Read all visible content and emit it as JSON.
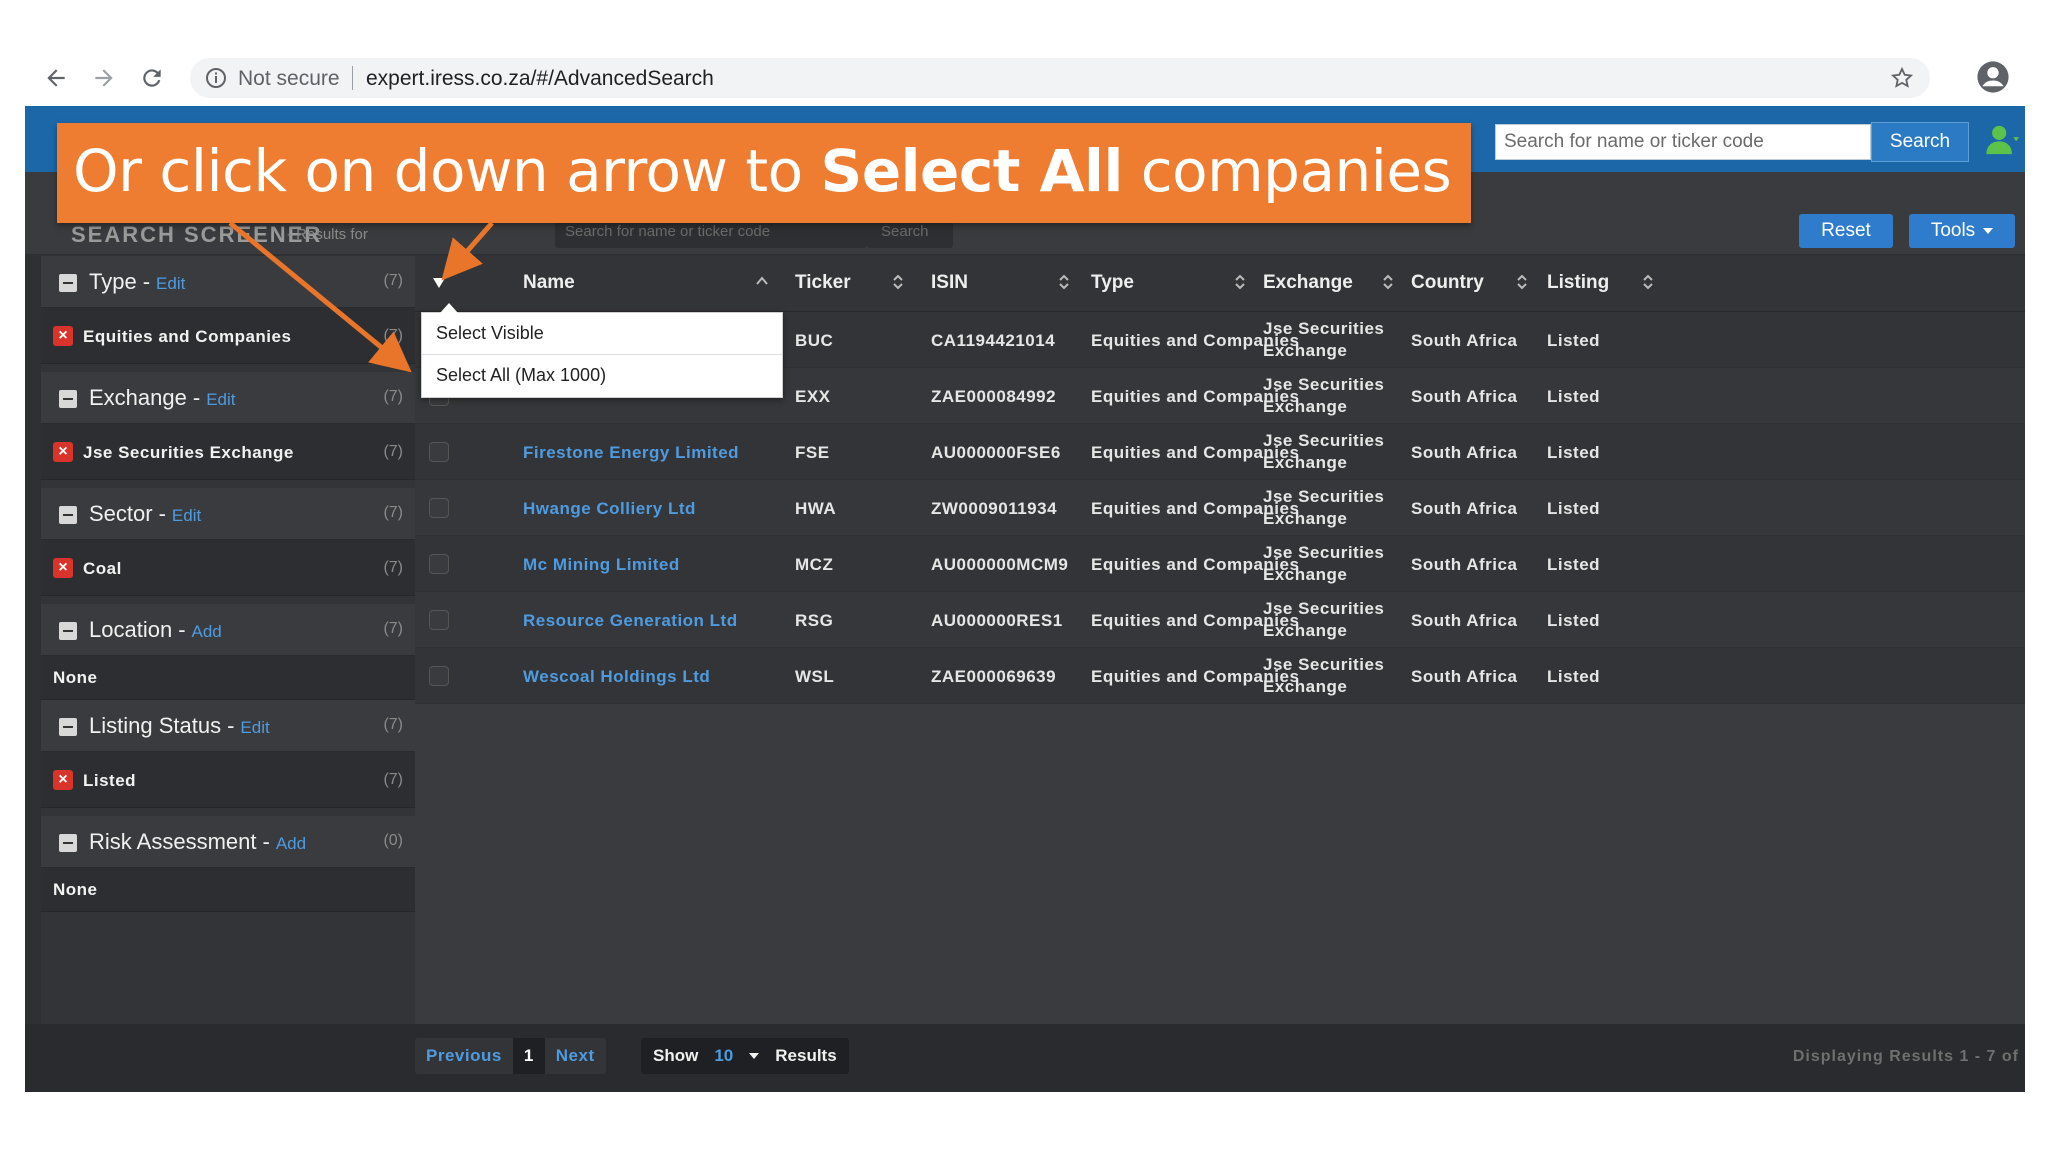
{
  "browser": {
    "security_label": "Not secure",
    "url": "expert.iress.co.za/#/AdvancedSearch"
  },
  "topbar": {
    "search_placeholder": "Search for name or ticker code",
    "search_button": "Search"
  },
  "header": {
    "title": "SEARCH SCREENER",
    "subtitle": "- Results for",
    "ghost_search_placeholder": "Search for name or ticker code",
    "ghost_search_button": "Search",
    "reset_button": "Reset",
    "tools_button": "Tools"
  },
  "sidebar": {
    "sections": [
      {
        "title": "Type",
        "action": "Edit",
        "count": "(7)",
        "item": "Equities and Companies",
        "item_count": "(7)",
        "removable": true
      },
      {
        "title": "Exchange",
        "action": "Edit",
        "count": "(7)",
        "item": "Jse Securities Exchange",
        "item_count": "(7)",
        "removable": true
      },
      {
        "title": "Sector",
        "action": "Edit",
        "count": "(7)",
        "item": "Coal",
        "item_count": "(7)",
        "removable": true
      },
      {
        "title": "Location",
        "action": "Add",
        "count": "(7)",
        "item": "None",
        "item_count": "",
        "removable": false
      },
      {
        "title": "Listing Status",
        "action": "Edit",
        "count": "(7)",
        "item": "Listed",
        "item_count": "(7)",
        "removable": true
      },
      {
        "title": "Risk Assessment",
        "action": "Add",
        "count": "(0)",
        "item": "None",
        "item_count": "",
        "removable": false
      }
    ]
  },
  "table": {
    "columns": [
      "Name",
      "Ticker",
      "ISIN",
      "Type",
      "Exchange",
      "Country",
      "Listing"
    ],
    "rows": [
      {
        "name": "",
        "ticker": "BUC",
        "isin": "CA1194421014",
        "type": "Equities and Companies",
        "exchange": "Jse Securities Exchange",
        "country": "South Africa",
        "listing": "Listed"
      },
      {
        "name": "",
        "ticker": "EXX",
        "isin": "ZAE000084992",
        "type": "Equities and Companies",
        "exchange": "Jse Securities Exchange",
        "country": "South Africa",
        "listing": "Listed"
      },
      {
        "name": "Firestone Energy Limited",
        "ticker": "FSE",
        "isin": "AU000000FSE6",
        "type": "Equities and Companies",
        "exchange": "Jse Securities Exchange",
        "country": "South Africa",
        "listing": "Listed"
      },
      {
        "name": "Hwange Colliery Ltd",
        "ticker": "HWA",
        "isin": "ZW0009011934",
        "type": "Equities and Companies",
        "exchange": "Jse Securities Exchange",
        "country": "South Africa",
        "listing": "Listed"
      },
      {
        "name": "Mc Mining Limited",
        "ticker": "MCZ",
        "isin": "AU000000MCM9",
        "type": "Equities and Companies",
        "exchange": "Jse Securities Exchange",
        "country": "South Africa",
        "listing": "Listed"
      },
      {
        "name": "Resource Generation Ltd",
        "ticker": "RSG",
        "isin": "AU000000RES1",
        "type": "Equities and Companies",
        "exchange": "Jse Securities Exchange",
        "country": "South Africa",
        "listing": "Listed"
      },
      {
        "name": "Wescoal Holdings Ltd",
        "ticker": "WSL",
        "isin": "ZAE000069639",
        "type": "Equities and Companies",
        "exchange": "Jse Securities Exchange",
        "country": "South Africa",
        "listing": "Listed"
      }
    ]
  },
  "dropdown": {
    "items": [
      "Select Visible",
      "Select All (Max 1000)"
    ]
  },
  "footer": {
    "previous": "Previous",
    "current_page": "1",
    "next": "Next",
    "show_label": "Show",
    "show_value": "10",
    "results_label": "Results",
    "displaying": "Displaying Results 1 - 7 of"
  },
  "callout": {
    "text_before": "Or click on down arrow to ",
    "text_bold": "Select All",
    "text_after": " companies"
  },
  "colors": {
    "callout": "#ee7d31",
    "link": "#4f9be0",
    "topbar": "#1c67a8",
    "remove": "#d9342b"
  }
}
